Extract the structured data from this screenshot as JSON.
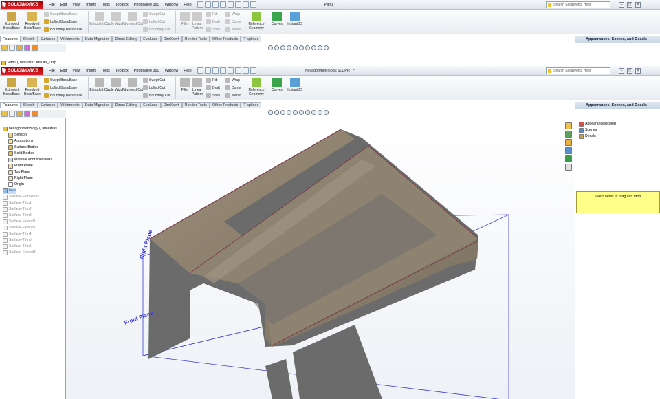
{
  "app": {
    "name": "SOLIDWORKS"
  },
  "menu": [
    "File",
    "Edit",
    "View",
    "Insert",
    "Tools",
    "Toolbox",
    "PhotoView 360",
    "Window",
    "Help"
  ],
  "window1": {
    "title": "Part1 *"
  },
  "window2": {
    "title": "hexagonmetrology.SLDPRT *"
  },
  "help_search": {
    "placeholder": "Search SolidWorks Help"
  },
  "ribbon": {
    "extruded_boss": "Extruded Boss/Base",
    "revolved_boss": "Revolved Boss/Base",
    "swept_boss": "Swept Boss/Base",
    "lofted_boss": "Lofted Boss/Base",
    "boundary_boss": "Boundary Boss/Base",
    "extruded_cut": "Extruded Cut",
    "hole_wizard": "Hole Wizard",
    "revolved_cut": "Revolved Cut",
    "swept_cut": "Swept Cut",
    "lofted_cut": "Lofted Cut",
    "boundary_cut": "Boundary Cut",
    "fillet": "Fillet",
    "linear_pattern": "Linear Pattern",
    "rib": "Rib",
    "draft": "Draft",
    "shell": "Shell",
    "wrap": "Wrap",
    "dome": "Dome",
    "mirror": "Mirror",
    "reference_geometry": "Reference Geometry",
    "curves": "Curves",
    "instant3d": "Instant3D"
  },
  "tabs": [
    "Features",
    "Sketch",
    "Surfaces",
    "Weldments",
    "Data Migration",
    "Direct Editing",
    "Evaluate",
    "DimXpert",
    "Render Tools",
    "Office Products",
    "T-splines"
  ],
  "tree1": {
    "root": "Part1  (Default<<Default>_Disp"
  },
  "tree2": {
    "root": "hexagonmetrology  (Default<<D",
    "items": [
      "Sensors",
      "Annotations",
      "Surface Bodies",
      "Solid Bodies",
      "Material <not specified>",
      "Front Plane",
      "Top Plane",
      "Right Plane",
      "Origin",
      "hexa"
    ],
    "features": [
      "Surface-Extracted1",
      "Surface-Trim1",
      "Surface-Trim2",
      "Surface-Trim3",
      "Surface-Extend1",
      "Surface-Extend2",
      "Surface-Trim4",
      "Surface-Trim5",
      "Surface-Trim6",
      "Surface-Extend3"
    ]
  },
  "taskpane": {
    "title": "Appearances, Scenes, and Decals",
    "items": [
      "Appearances(color)",
      "Scenes",
      "Decals"
    ],
    "drop_hint": "Select items to drag and drop."
  },
  "viewport": {
    "plane_labels": [
      "Right Plane",
      "Front Plane"
    ]
  },
  "colors": {
    "mesh_top": "#8a7d6b",
    "mesh_side": "#6b6b6b",
    "plane": "#3a3ad8",
    "brand": "#c00000"
  }
}
